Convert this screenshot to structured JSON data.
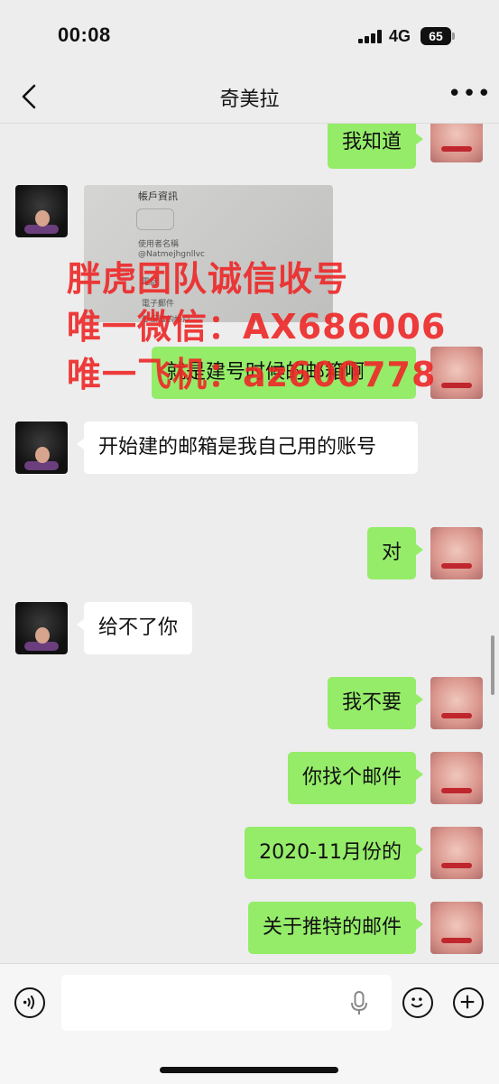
{
  "status": {
    "time": "00:08",
    "network": "4G",
    "battery": "65"
  },
  "header": {
    "title": "奇美拉",
    "more": "•••"
  },
  "messages": [
    {
      "side": "right",
      "text": "我知道"
    },
    {
      "side": "left",
      "type": "image"
    },
    {
      "side": "right",
      "text": "就是建号时候的邮箱啊"
    },
    {
      "side": "left",
      "text": "开始建的邮箱是我自己用的账号"
    },
    {
      "side": "right",
      "text": "对"
    },
    {
      "side": "left",
      "text": "给不了你"
    },
    {
      "side": "right",
      "text": "我不要"
    },
    {
      "side": "right",
      "text": "你找个邮件"
    },
    {
      "side": "right",
      "text": "2020-11月份的"
    },
    {
      "side": "right",
      "text": "关于推特的邮件"
    }
  ],
  "screenshot": {
    "title": "帳戶資訊",
    "username_label": "使用者名稱",
    "username": "@Natmejhgnllvc",
    "phone_label": "電話",
    "email_label": "電子郵件",
    "protected_label": "受保護的帳戶"
  },
  "watermark": {
    "line1": "胖虎团队诚信收号",
    "line2": "唯一微信：AX686006",
    "line3": "唯一飞机：az600778"
  },
  "input": {
    "placeholder": ""
  }
}
